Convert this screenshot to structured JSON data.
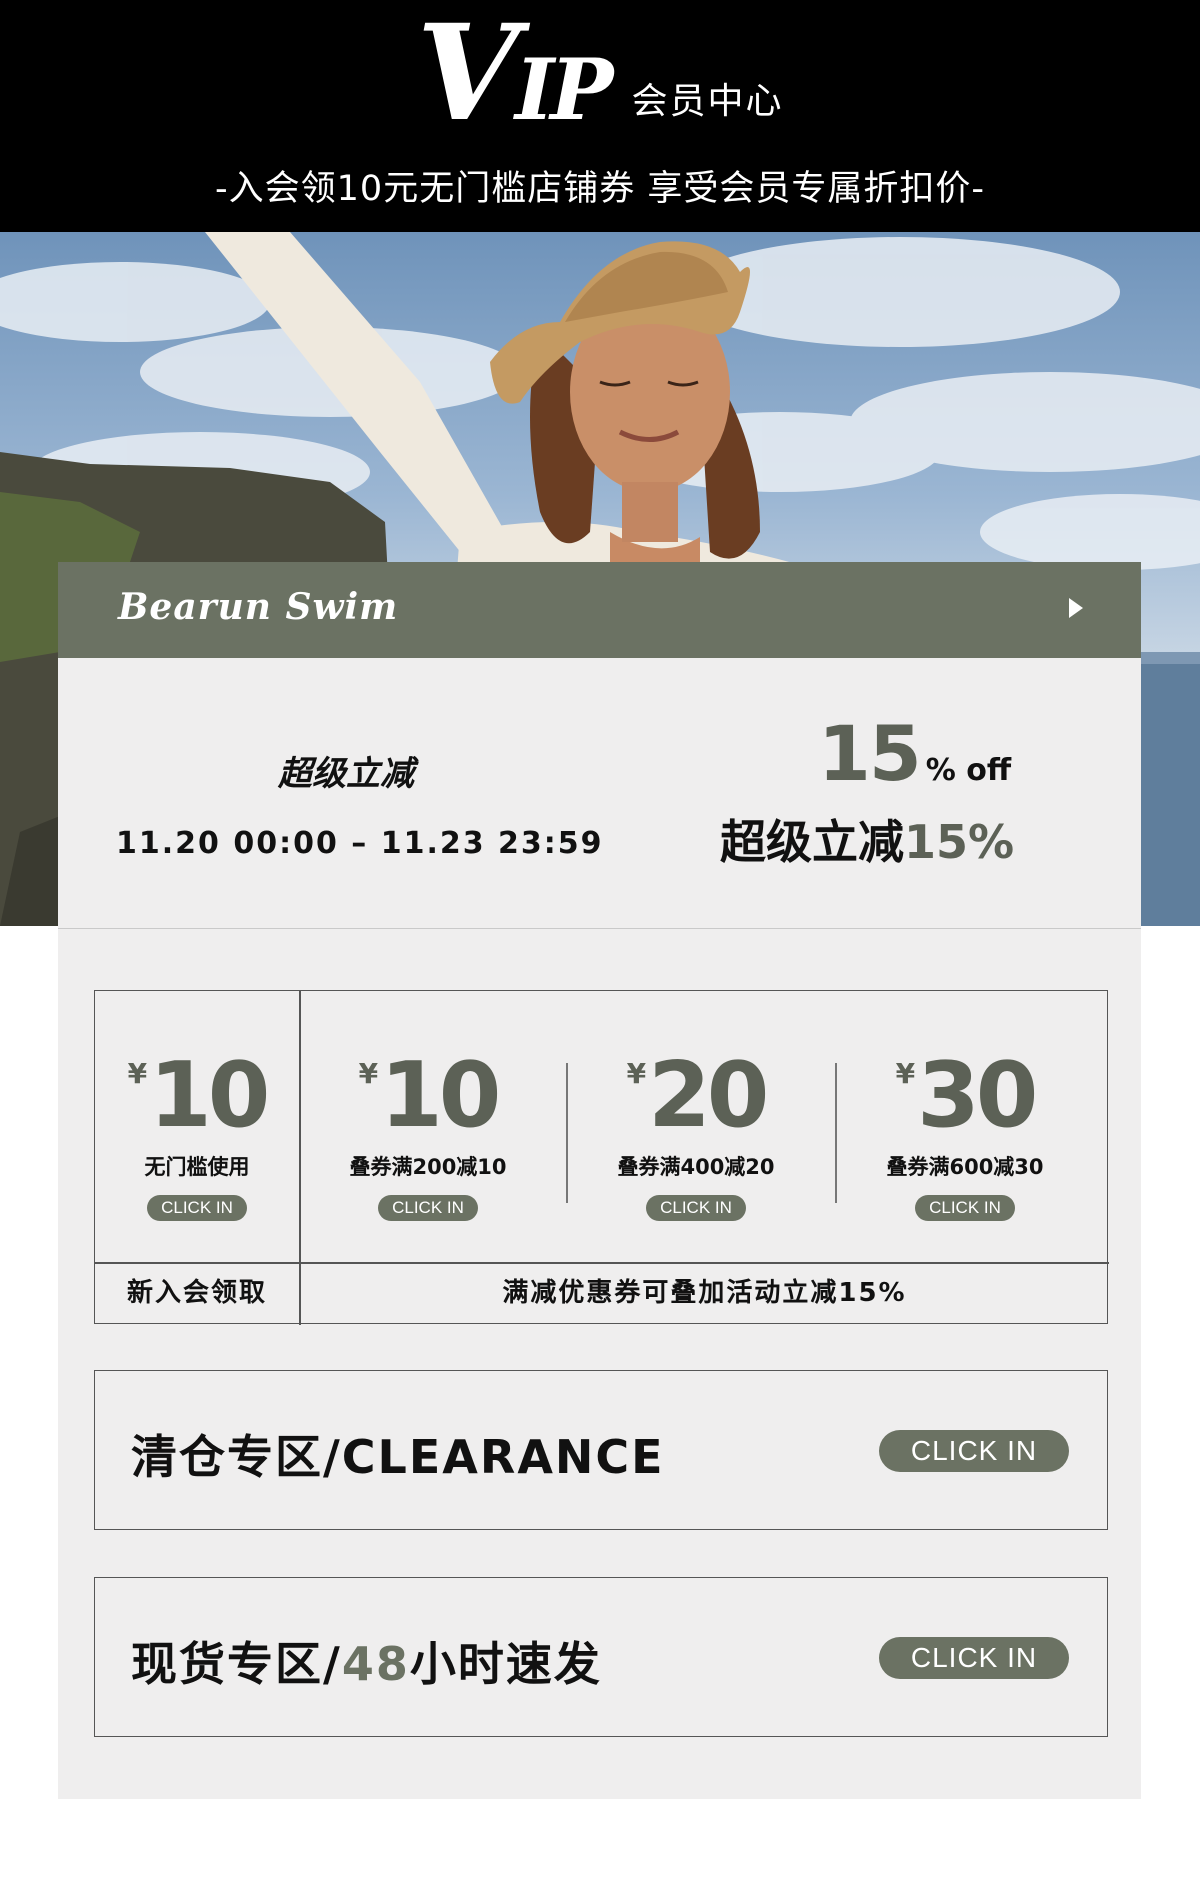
{
  "header": {
    "logo_v": "V",
    "logo_ip": "IP",
    "subtitle": "会员中心",
    "tagline": "-入会领10元无门槛店铺券 享受会员专属折扣价-"
  },
  "hero": {
    "image": "woman-in-straw-hat-seaside-photo"
  },
  "brand_bar": {
    "name": "Bearun Swim",
    "arrow_icon": "play-arrow-icon"
  },
  "promo": {
    "title": "超级立减",
    "dates": "11.20 00:00 – 11.23 23:59",
    "percent_number": "15",
    "percent_suffix": "% off",
    "headline_text": "超级立减",
    "headline_percent": "15%"
  },
  "coupons": {
    "items": [
      {
        "currency": "¥",
        "amount": "10",
        "desc": "无门槛使用",
        "button": "CLICK IN"
      },
      {
        "currency": "¥",
        "amount": "10",
        "desc": "叠券满200减10",
        "button": "CLICK IN"
      },
      {
        "currency": "¥",
        "amount": "20",
        "desc": "叠券满400减20",
        "button": "CLICK IN"
      },
      {
        "currency": "¥",
        "amount": "30",
        "desc": "叠券满600减30",
        "button": "CLICK IN"
      }
    ],
    "left_label": "新入会领取",
    "right_label": "满减优惠券可叠加活动立减15%"
  },
  "zones": [
    {
      "title_prefix": "清仓专区/CLEARANCE",
      "title_accent": "",
      "title_suffix": "",
      "button": "CLICK IN"
    },
    {
      "title_prefix": "现货专区/",
      "title_accent": "48",
      "title_suffix": "小时速发",
      "button": "CLICK IN"
    }
  ],
  "colors": {
    "accent": "#6b7263",
    "accent_text": "#5c6156",
    "panel_bg": "#efeeee",
    "header_bg": "#000000"
  }
}
